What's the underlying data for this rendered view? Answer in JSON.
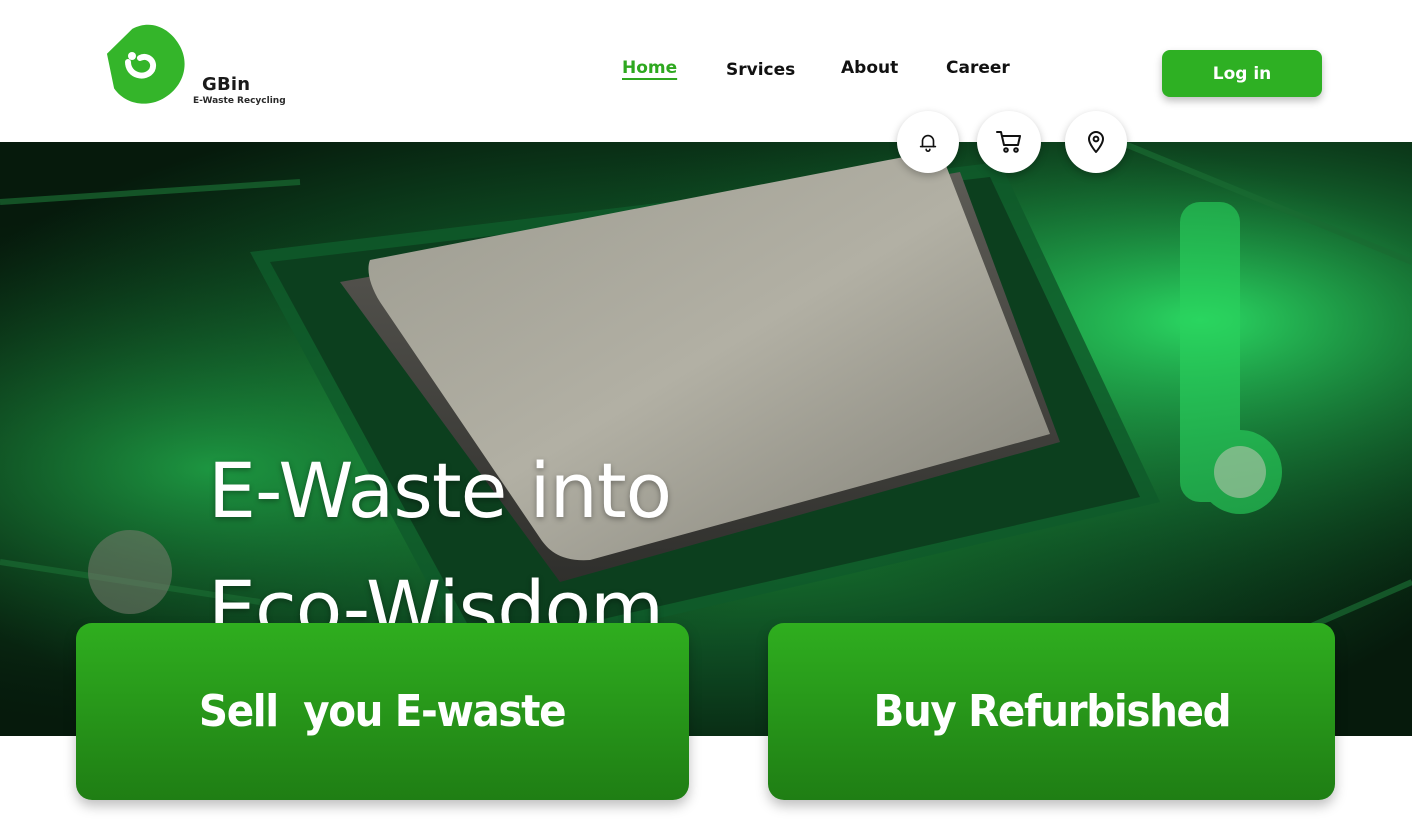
{
  "brand": {
    "name": "GBin",
    "tagline": "E-Waste Recycling",
    "color": "#2eb023"
  },
  "nav": {
    "items": [
      {
        "label": "Home",
        "active": true
      },
      {
        "label": "Srvices",
        "active": false
      },
      {
        "label": "About",
        "active": false
      },
      {
        "label": "Career",
        "active": false
      }
    ]
  },
  "header": {
    "login_label": "Log in"
  },
  "quick_icons": [
    {
      "name": "bell-icon"
    },
    {
      "name": "cart-icon"
    },
    {
      "name": "location-pin-icon"
    }
  ],
  "hero": {
    "title_line1": "E-Waste into",
    "title_line2": "Eco-Wisdom"
  },
  "cta": {
    "sell_label": "Sell  you E-waste",
    "buy_label": "Buy Refurbished"
  },
  "colors": {
    "accent": "#2eb023",
    "active_link": "#2ea81f",
    "cta_top": "#2fae1f",
    "cta_bottom": "#1f7e14"
  }
}
